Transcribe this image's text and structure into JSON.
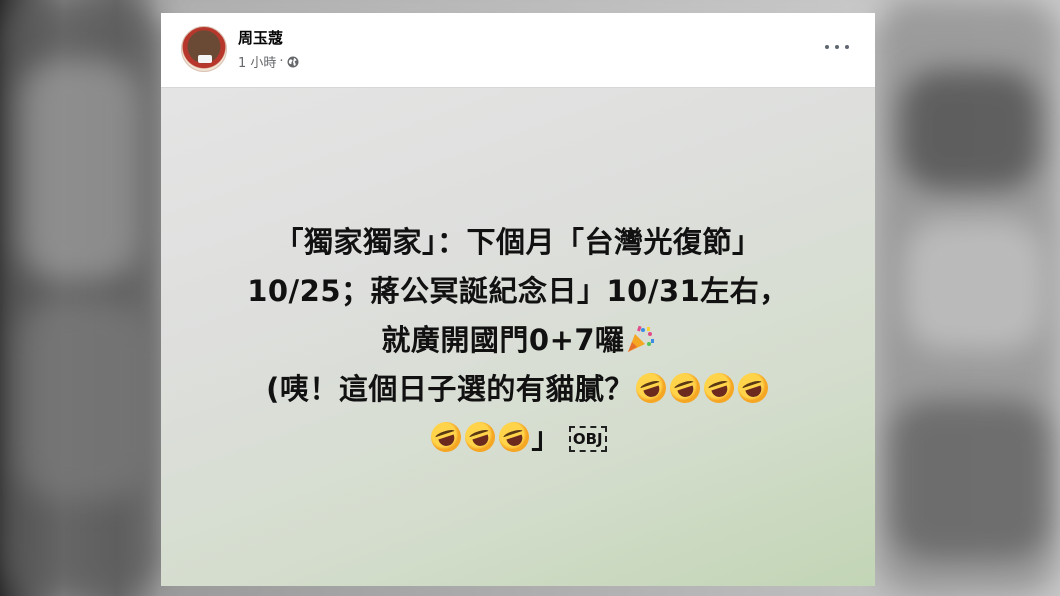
{
  "post": {
    "author": "周玉蔻",
    "time": "1 小時",
    "separator": "·",
    "privacy_icon": "globe-icon",
    "menu_icon": "more-options-icon",
    "text_lines": [
      "「獨家獨家」：下個月「台灣光復節」",
      "10/25；蔣公冥誕紀念日」10/31左右，",
      "就廣開國門0+7囉",
      "(咦！這個日子選的有貓膩？",
      "」"
    ],
    "obj_placeholder": "OBJ",
    "emoji": {
      "party": "party-popper-icon",
      "laugh": "rolling-laughing-emoji"
    },
    "background_gradient": [
      "#e4e4e4",
      "#c2d5b5"
    ]
  }
}
